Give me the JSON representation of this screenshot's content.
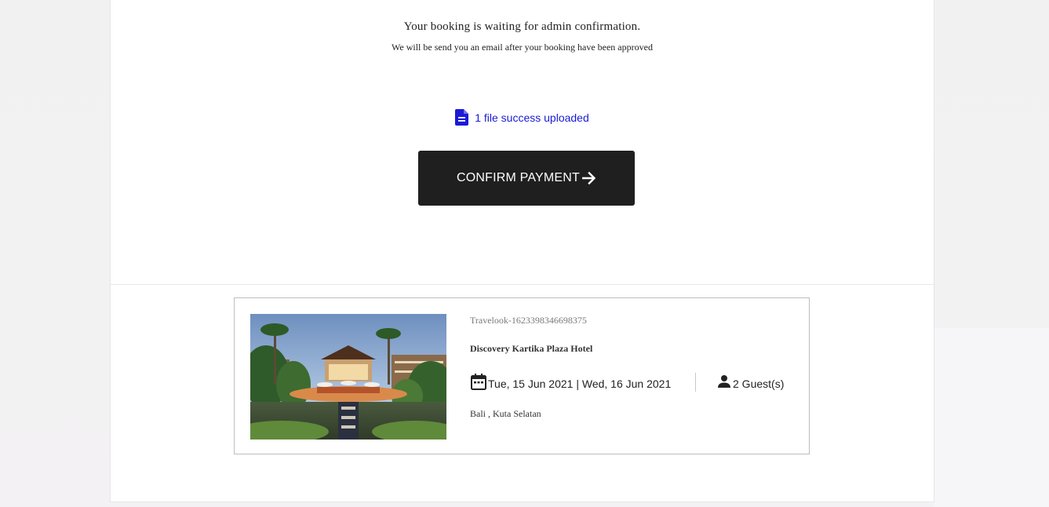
{
  "status": {
    "title": "Your booking is waiting for admin confirmation.",
    "subtitle": "We will be send you an email after your booking have been approved"
  },
  "upload": {
    "icon": "document-icon",
    "text": "1 file success uploaded",
    "color": "#1a1ad6"
  },
  "confirm_button": {
    "label": "CONFIRM PAYMENT",
    "icon": "arrow-right-icon",
    "background": "#1f1f1f"
  },
  "booking": {
    "id": "Travelook-1623398346698375",
    "hotel_name": "Discovery Kartika Plaza Hotel",
    "dates": "Tue, 15 Jun 2021 | Wed, 16 Jun 2021",
    "dates_icon": "calendar-icon",
    "guests": "2 Guest(s)",
    "guests_icon": "person-icon",
    "location": "Bali , Kuta Selatan"
  }
}
